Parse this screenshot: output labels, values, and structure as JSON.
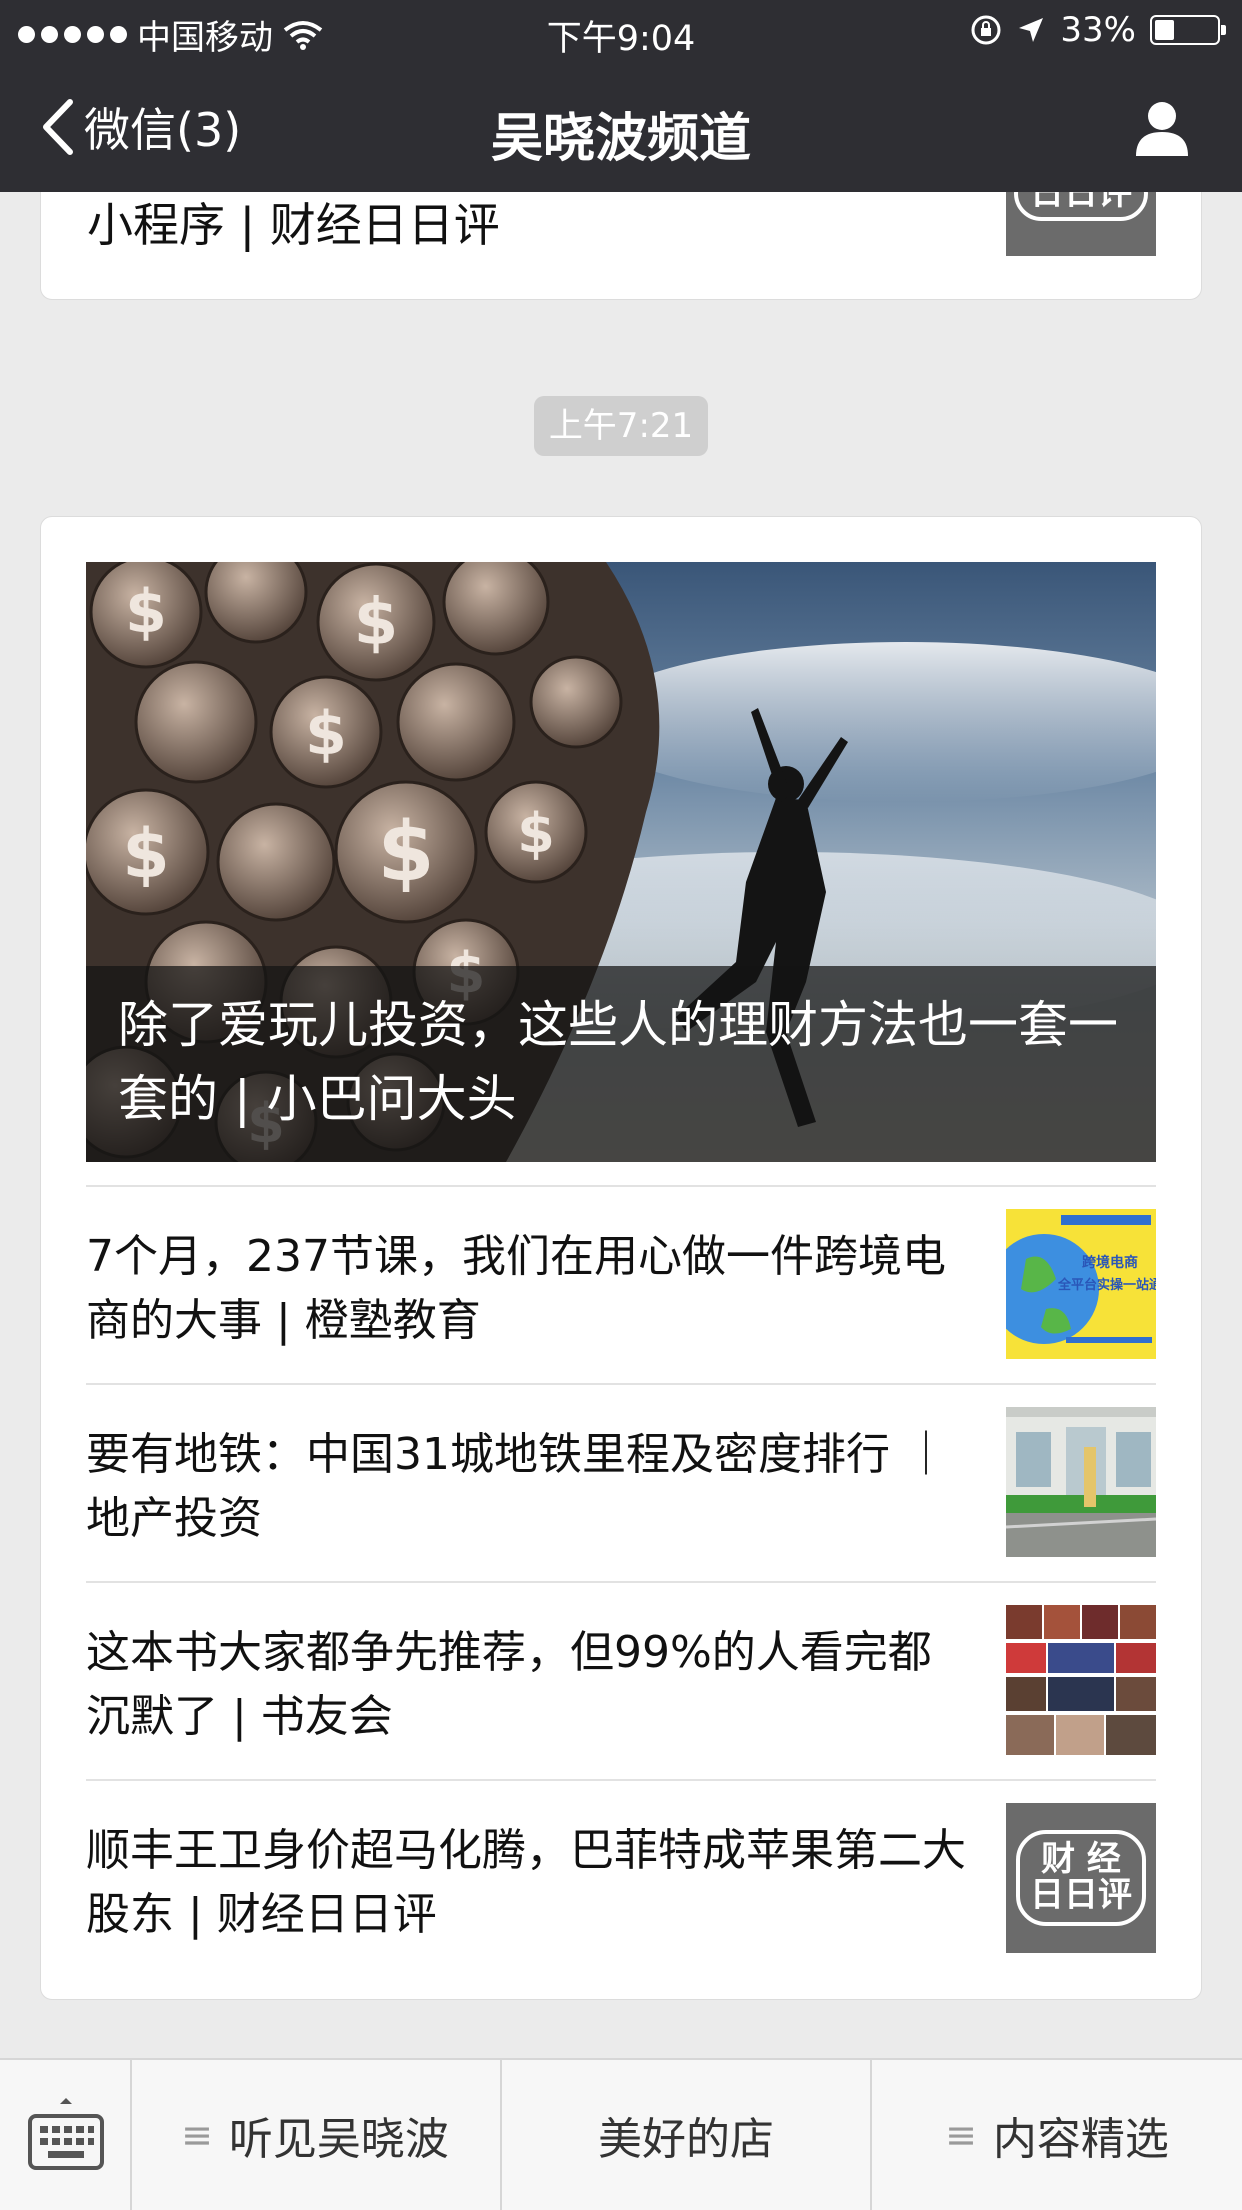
{
  "status_bar": {
    "carrier": "中国移动",
    "time": "下午9:04",
    "battery": "33%",
    "battery_level": 0.33
  },
  "nav": {
    "back_label": "微信(3)",
    "title": "吴晓波频道"
  },
  "top_card": {
    "title": "小程序 | 财经日日评",
    "thumb_text": "日日评"
  },
  "time_divider": "上午7:21",
  "main_card": {
    "hero_title": "除了爱玩儿投资，这些人的理财方法也一套一套的 | 小巴问大头",
    "items": [
      {
        "title": "7个月，237节课，我们在用心做一件跨境电商的大事 | 橙塾教育",
        "thumb": "ecommerce-poster",
        "thumb_text": "跨境电商\n全平台实操一站通"
      },
      {
        "title": "要有地铁：中国31城地铁里程及密度排行 ｜地产投资",
        "thumb": "subway-photo"
      },
      {
        "title": "这本书大家都争先推荐，但99%的人看完都沉默了 | 书友会",
        "thumb": "event-collage"
      },
      {
        "title": "顺丰王卫身价超马化腾，巴菲特成苹果第二大股东 | 财经日日评",
        "thumb": "caijing-logo",
        "thumb_line1": "财 经",
        "thumb_line2": "日日评"
      }
    ]
  },
  "bottom_menu": {
    "items": [
      "听见吴晓波",
      "美好的店",
      "内容精选"
    ]
  }
}
